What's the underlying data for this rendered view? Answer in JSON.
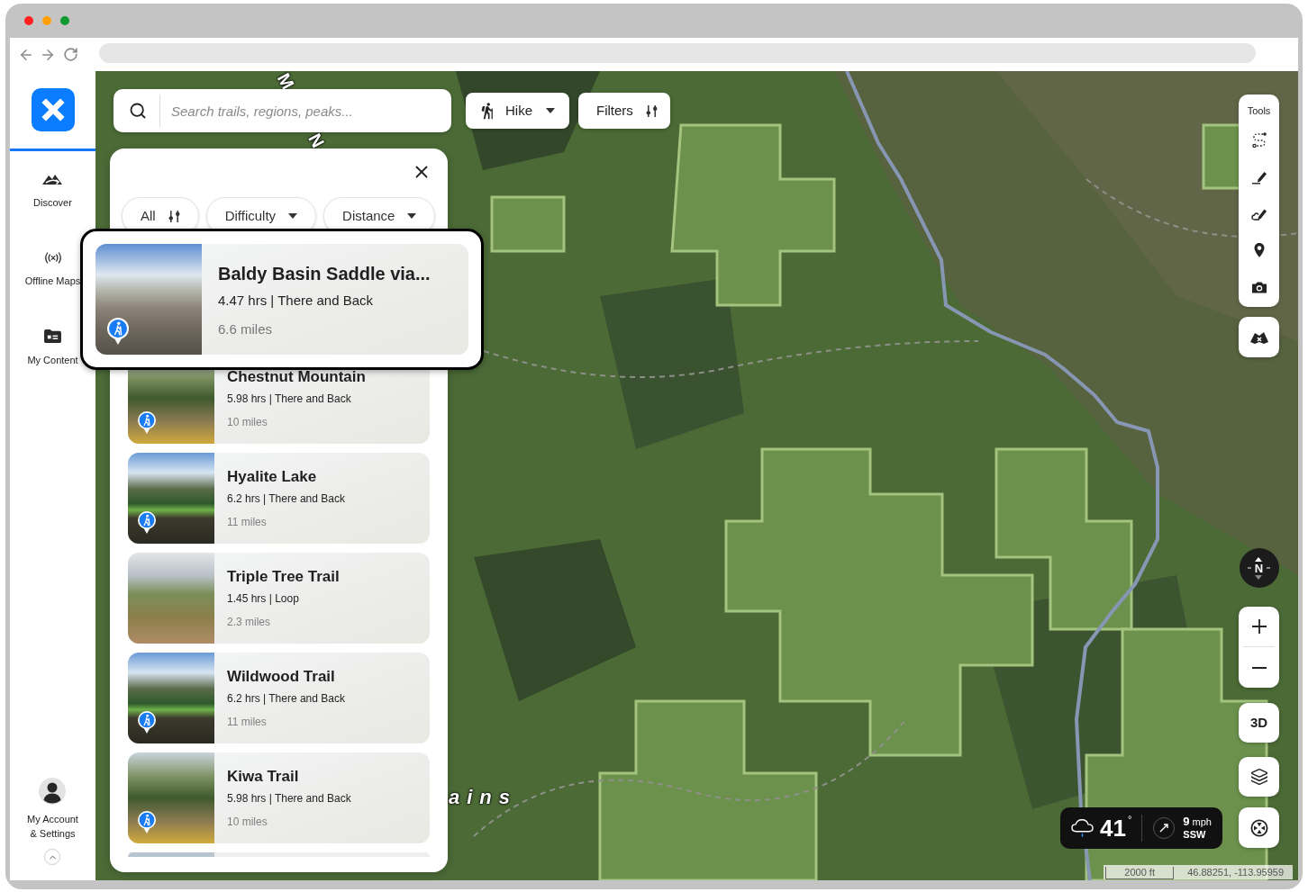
{
  "sidebar": {
    "items": [
      {
        "label": "Discover"
      },
      {
        "label": "Offline Maps"
      },
      {
        "label": "My Content"
      }
    ],
    "account": {
      "lines": [
        "My Account",
        "& Settings"
      ]
    }
  },
  "search": {
    "placeholder": "Search trails, regions, peaks..."
  },
  "activity_button": {
    "label": "Hike"
  },
  "filters_button": {
    "label": "Filters"
  },
  "trail_panel": {
    "chips": [
      {
        "label": "All",
        "kind": "filter"
      },
      {
        "label": "Difficulty",
        "kind": "dropdown"
      },
      {
        "label": "Distance",
        "kind": "dropdown"
      }
    ],
    "featured": {
      "title": "Baldy Basin Saddle via...",
      "detail": "4.47 hrs | There and Back",
      "distance": "6.6 miles",
      "marker": true
    },
    "trails": [
      {
        "title": "Chestnut Mountain",
        "detail": "5.98 hrs | There and Back",
        "distance": "10 miles",
        "marker": true
      },
      {
        "title": "Hyalite Lake",
        "detail": "6.2 hrs | There and Back",
        "distance": "11 miles",
        "marker": true
      },
      {
        "title": "Triple Tree Trail",
        "detail": "1.45 hrs | Loop",
        "distance": "2.3 miles",
        "marker": false
      },
      {
        "title": "Wildwood Trail",
        "detail": "6.2 hrs | There and Back",
        "distance": "11 miles",
        "marker": true
      },
      {
        "title": "Kiwa Trail",
        "detail": "5.98 hrs | There and Back",
        "distance": "10 miles",
        "marker": true
      }
    ]
  },
  "map_labels": [
    {
      "text": "M"
    },
    {
      "text": "N"
    },
    {
      "text": "ains"
    }
  ],
  "tools": {
    "title": "Tools"
  },
  "compass": {
    "label": "N"
  },
  "view_button": {
    "label": "3D"
  },
  "weather": {
    "temperature": "41",
    "degree": "°",
    "wind_speed": "**9** mph",
    "wind_direction": "SSW"
  },
  "scale": {
    "label": "2000 ft",
    "coordinates": "46.88251, -113.95959"
  }
}
